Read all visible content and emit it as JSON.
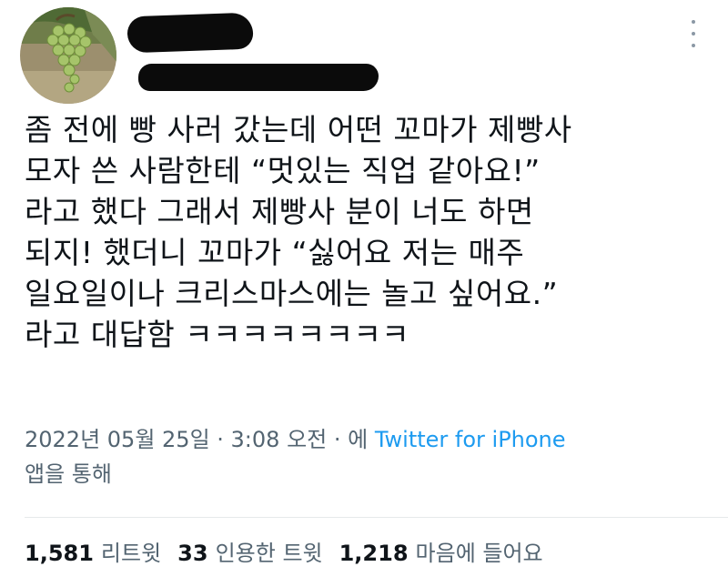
{
  "tweet": {
    "lines": [
      "좀 전에 빵 사러 갔는데 어떤 꼬마가 제빵사",
      "모자 쓴 사람한테 “멋있는 직업 같아요!”",
      "라고 했다 그래서 제빵사 분이 너도 하면",
      "되지! 했더니 꼬마가 “싫어요 저는 매주",
      "일요일이나 크리스마스에는 놀고 싶어요.”",
      "라고 대답함 ㅋㅋㅋㅋㅋㅋㅋㅋ"
    ]
  },
  "meta": {
    "datetime": "2022년 05월 25일 · 3:08 오전 · 에 ",
    "source": "Twitter for iPhone",
    "via": "앱을 통해"
  },
  "stats": {
    "retweets": {
      "count": "1,581",
      "label": "리트윗"
    },
    "quotes": {
      "count": "33",
      "label": "인용한 트윗"
    },
    "likes": {
      "count": "1,218",
      "label": "마음에 들어요"
    }
  },
  "colors": {
    "text": "#0f1419",
    "muted": "#536471",
    "link": "#1d9bf0"
  },
  "icons": {
    "avatar": "grapes-photo",
    "more": "more-vertical-icon"
  }
}
